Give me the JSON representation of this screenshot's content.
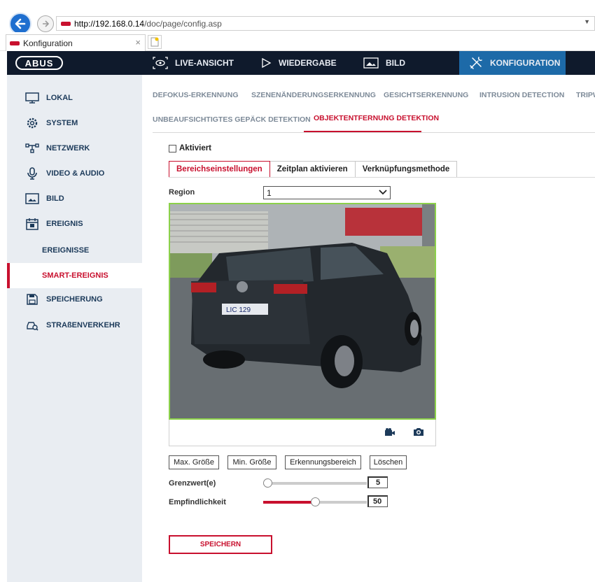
{
  "browser": {
    "url_host": "http://192.168.0.14",
    "url_path": "/doc/page/config.asp",
    "tab_title": "Konfiguration",
    "tab_close": "×"
  },
  "topnav": {
    "logo": "ABUS",
    "items": [
      {
        "label": "LIVE-ANSICHT",
        "icon": "eye-icon"
      },
      {
        "label": "WIEDERGABE",
        "icon": "play-icon"
      },
      {
        "label": "BILD",
        "icon": "image-icon"
      },
      {
        "label": "KONFIGURATION",
        "icon": "tools-icon",
        "active": true
      }
    ]
  },
  "sidebar": {
    "items": [
      {
        "label": "LOKAL",
        "icon": "monitor-icon"
      },
      {
        "label": "SYSTEM",
        "icon": "gear-icon"
      },
      {
        "label": "NETZWERK",
        "icon": "network-icon"
      },
      {
        "label": "VIDEO & AUDIO",
        "icon": "microphone-icon"
      },
      {
        "label": "BILD",
        "icon": "image-icon"
      },
      {
        "label": "EREIGNIS",
        "icon": "calendar-icon"
      },
      {
        "label": "SPEICHERUNG",
        "icon": "floppy-icon"
      },
      {
        "label": "STRAßENVERKEHR",
        "icon": "car-search-icon"
      }
    ],
    "subitems": [
      {
        "label": "EREIGNISSE"
      },
      {
        "label": "SMART-EREIGNIS",
        "active": true
      }
    ]
  },
  "subtabs": {
    "row1": [
      "DEFOKUS-ERKENNUNG",
      "SZENENÄNDERUNGSERKENNUNG",
      "GESICHTSERKENNUNG",
      "INTRUSION DETECTION",
      "TRIPW"
    ],
    "row2": [
      "UNBEAUFSICHTIGTES GEPÄCK DETEKTION",
      "OBJEKTENTFERNUNG DETEKTION"
    ]
  },
  "form": {
    "enabled_label": "Aktiviert",
    "enabled": false,
    "steps": [
      "Bereichseinstellungen",
      "Zeitplan aktivieren",
      "Verknüpfungsmethode"
    ],
    "region_label": "Region",
    "region_value": "1",
    "buttons": [
      "Max. Größe",
      "Min. Größe",
      "Erkennungsbereich",
      "Löschen"
    ],
    "threshold_label": "Grenzwert(e)",
    "threshold_value": "5",
    "sensitivity_label": "Empfindlichkeit",
    "sensitivity_value": "50",
    "save_label": "SPEICHERN"
  },
  "video": {
    "plate_text": "LIC 129",
    "icons": [
      "video-record-icon",
      "camera-icon"
    ]
  },
  "colors": {
    "accent": "#c8102e",
    "nav_bg": "#0f1a2c",
    "nav_active": "#1d6aa8",
    "roi_border": "#8cd14a"
  }
}
